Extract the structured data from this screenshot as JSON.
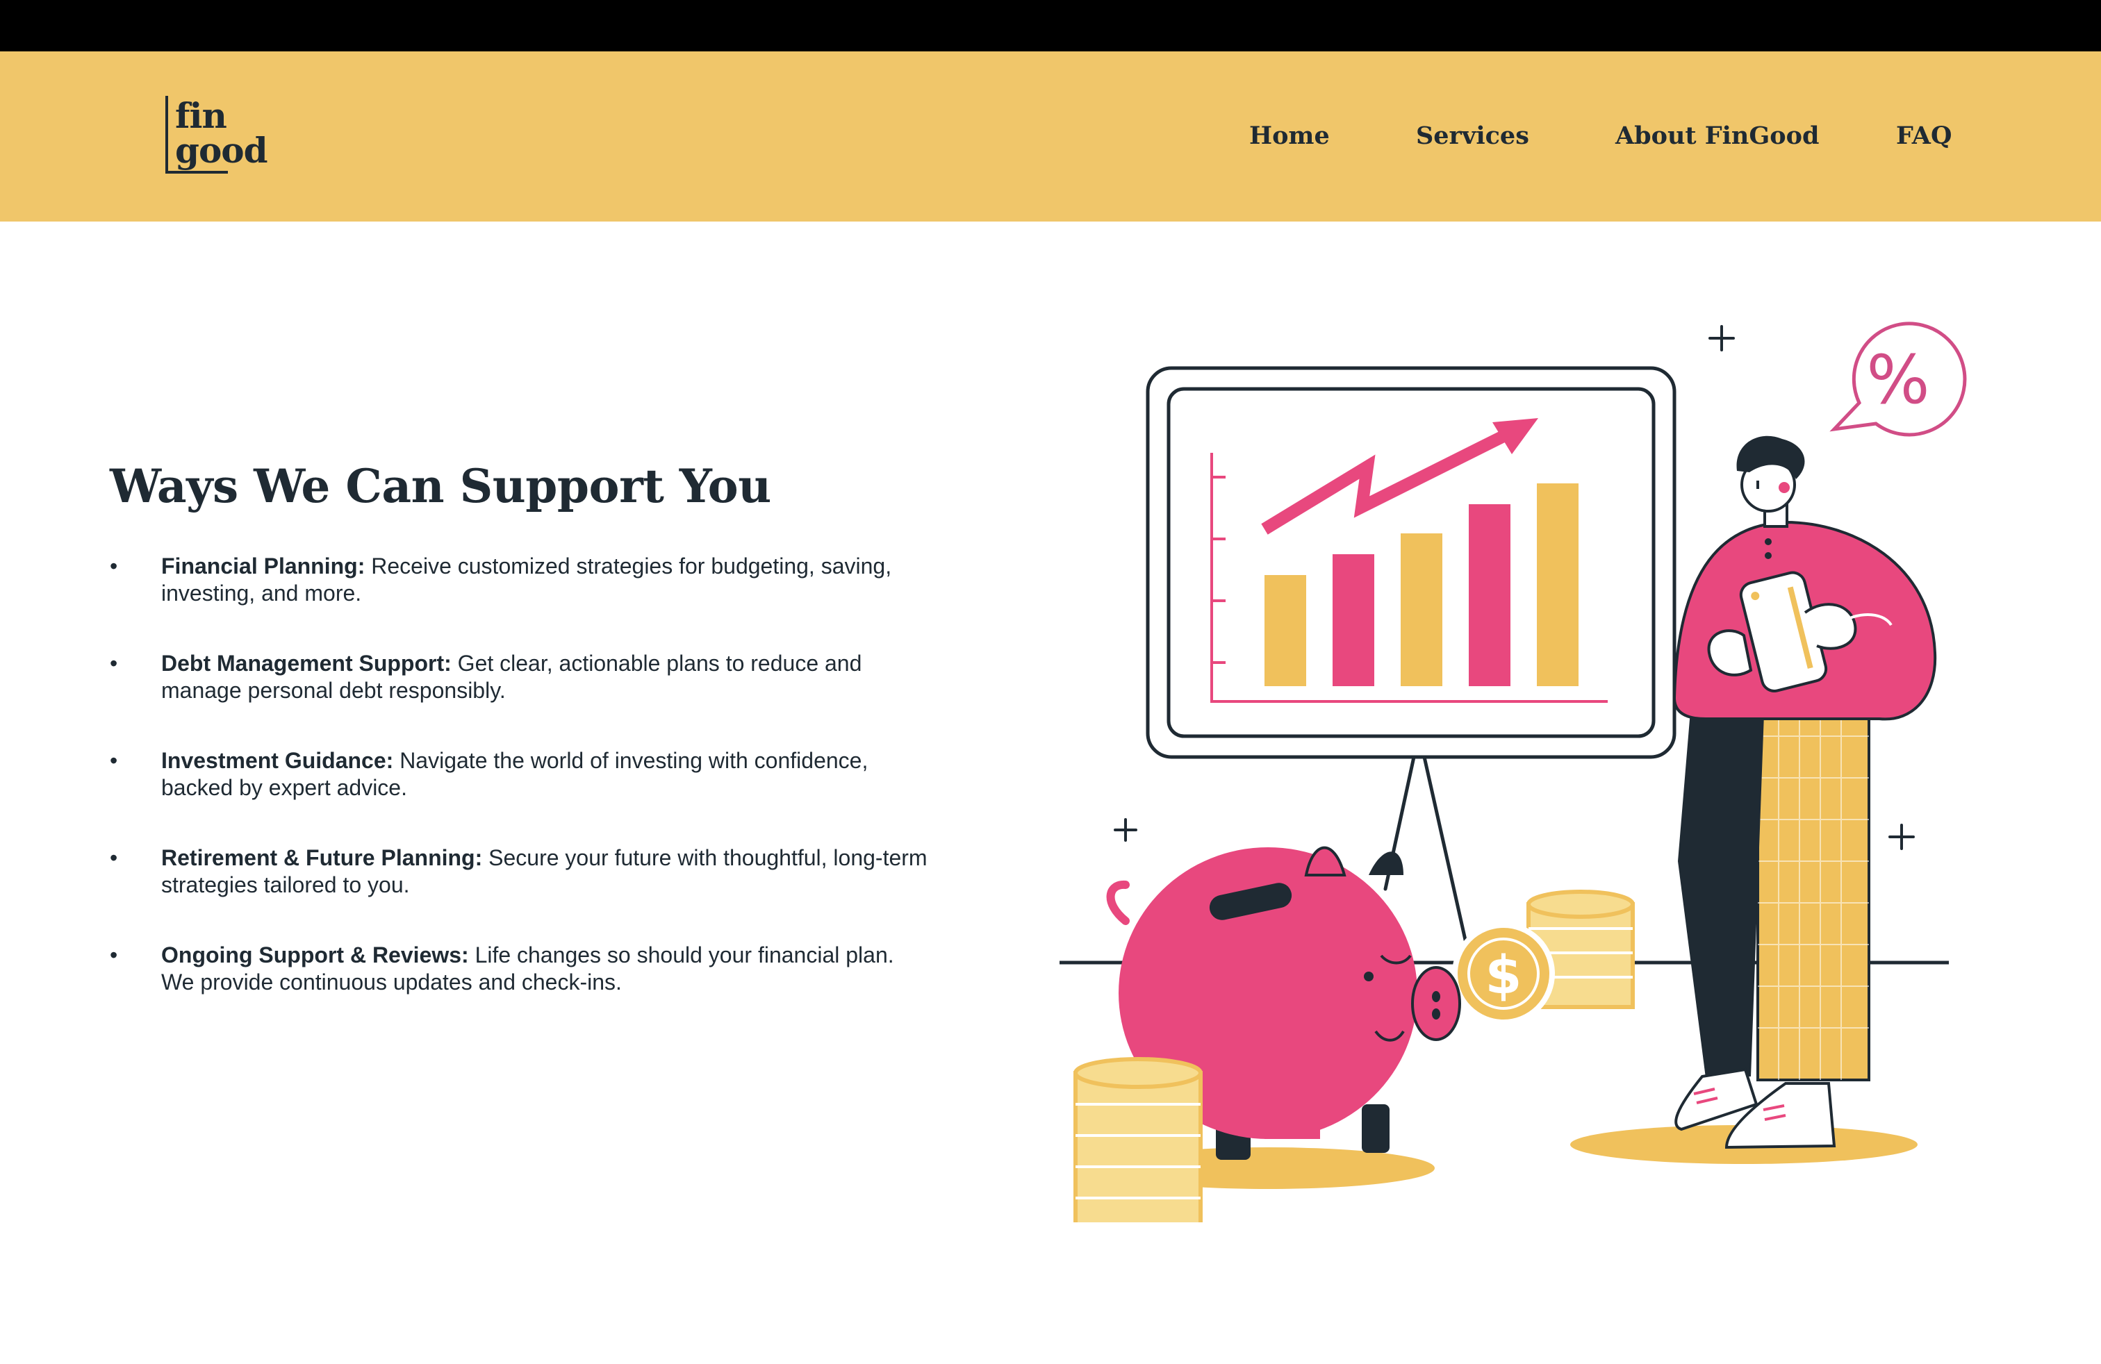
{
  "brand": {
    "logo_line1": "fin",
    "logo_line2": "good"
  },
  "nav": {
    "items": [
      {
        "label": "Home"
      },
      {
        "label": "Services"
      },
      {
        "label": "About FinGood"
      },
      {
        "label": "FAQ"
      }
    ]
  },
  "main": {
    "heading": "Ways We Can Support You",
    "services": [
      {
        "title": "Financial Planning:",
        "description": "Receive customized strategies for budgeting, saving, investing, and more."
      },
      {
        "title": "Debt Management Support:",
        "description": "Get clear, actionable plans to reduce and manage personal debt responsibly."
      },
      {
        "title": "Investment Guidance:",
        "description": "Navigate the world of investing with confidence, backed by expert advice."
      },
      {
        "title": "Retirement & Future Planning:",
        "description": "Secure your future with thoughtful, long-term strategies tailored to you."
      },
      {
        "title": "Ongoing Support & Reviews:",
        "description": "Life changes so should your financial plan. We provide continuous updates and check-ins."
      }
    ]
  },
  "illustration": {
    "percent_symbol": "%",
    "dollar_symbol": "$"
  },
  "colors": {
    "header_bg": "#f0c66a",
    "top_bar": "#000000",
    "text_dark": "#1f2a33",
    "accent_pink": "#e8487e",
    "accent_yellow": "#f0c15c"
  }
}
